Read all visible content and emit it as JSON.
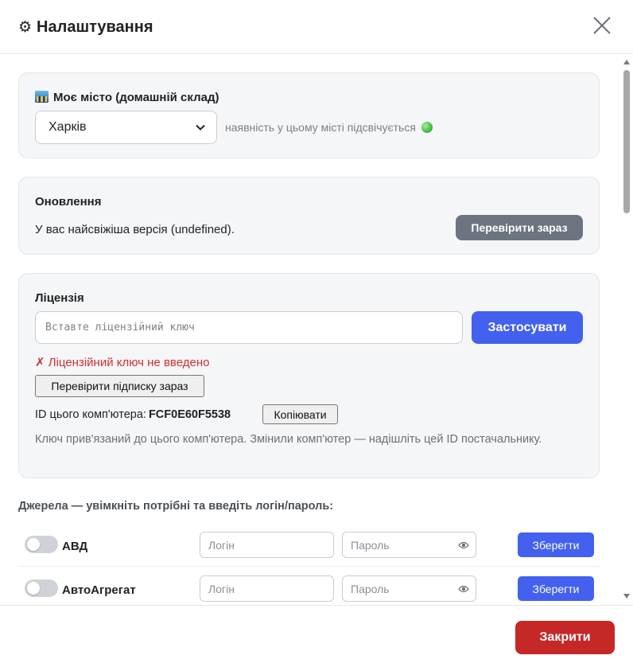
{
  "header": {
    "gear_glyph": "⚙",
    "title": "Налаштування"
  },
  "city": {
    "label": "Моє місто (домашній склад)",
    "selected": "Харків",
    "hint": "наявність у цьому місті підсвічується"
  },
  "update": {
    "label": "Оновлення",
    "status": "У вас найсвіжіша версія (undefined).",
    "check_button": "Перевірити зараз"
  },
  "license": {
    "label": "Ліцензія",
    "input_placeholder": "Вставте ліцензійний ключ",
    "apply_button": "Застосувати",
    "error": "✗ Ліцензійний ключ не введено",
    "check_subscription_button": "Перевірити підписку зараз",
    "computer_id_label": "ID цього комп'ютера:",
    "computer_id": "FCF0E60F5538",
    "copy_button": "Копіювати",
    "note": "Ключ прив'язаний до цього комп'ютера. Змінили комп'ютер — надішліть цей ID постачальнику."
  },
  "sources": {
    "title": "Джерела — увімкніть потрібні та введіть логін/пароль:",
    "items": [
      {
        "name": "АВД",
        "enabled": false,
        "login_placeholder": "Логін",
        "password_placeholder": "Пароль",
        "save_label": "Зберегти"
      },
      {
        "name": "АвтоАгрегат",
        "enabled": false,
        "login_placeholder": "Логін",
        "password_placeholder": "Пароль",
        "save_label": "Зберегти"
      }
    ]
  },
  "footer": {
    "close_button": "Закрити"
  },
  "colors": {
    "primary": "#4361ee",
    "danger": "#c62828",
    "secondary": "#6c7480",
    "error_text": "#d03030"
  }
}
